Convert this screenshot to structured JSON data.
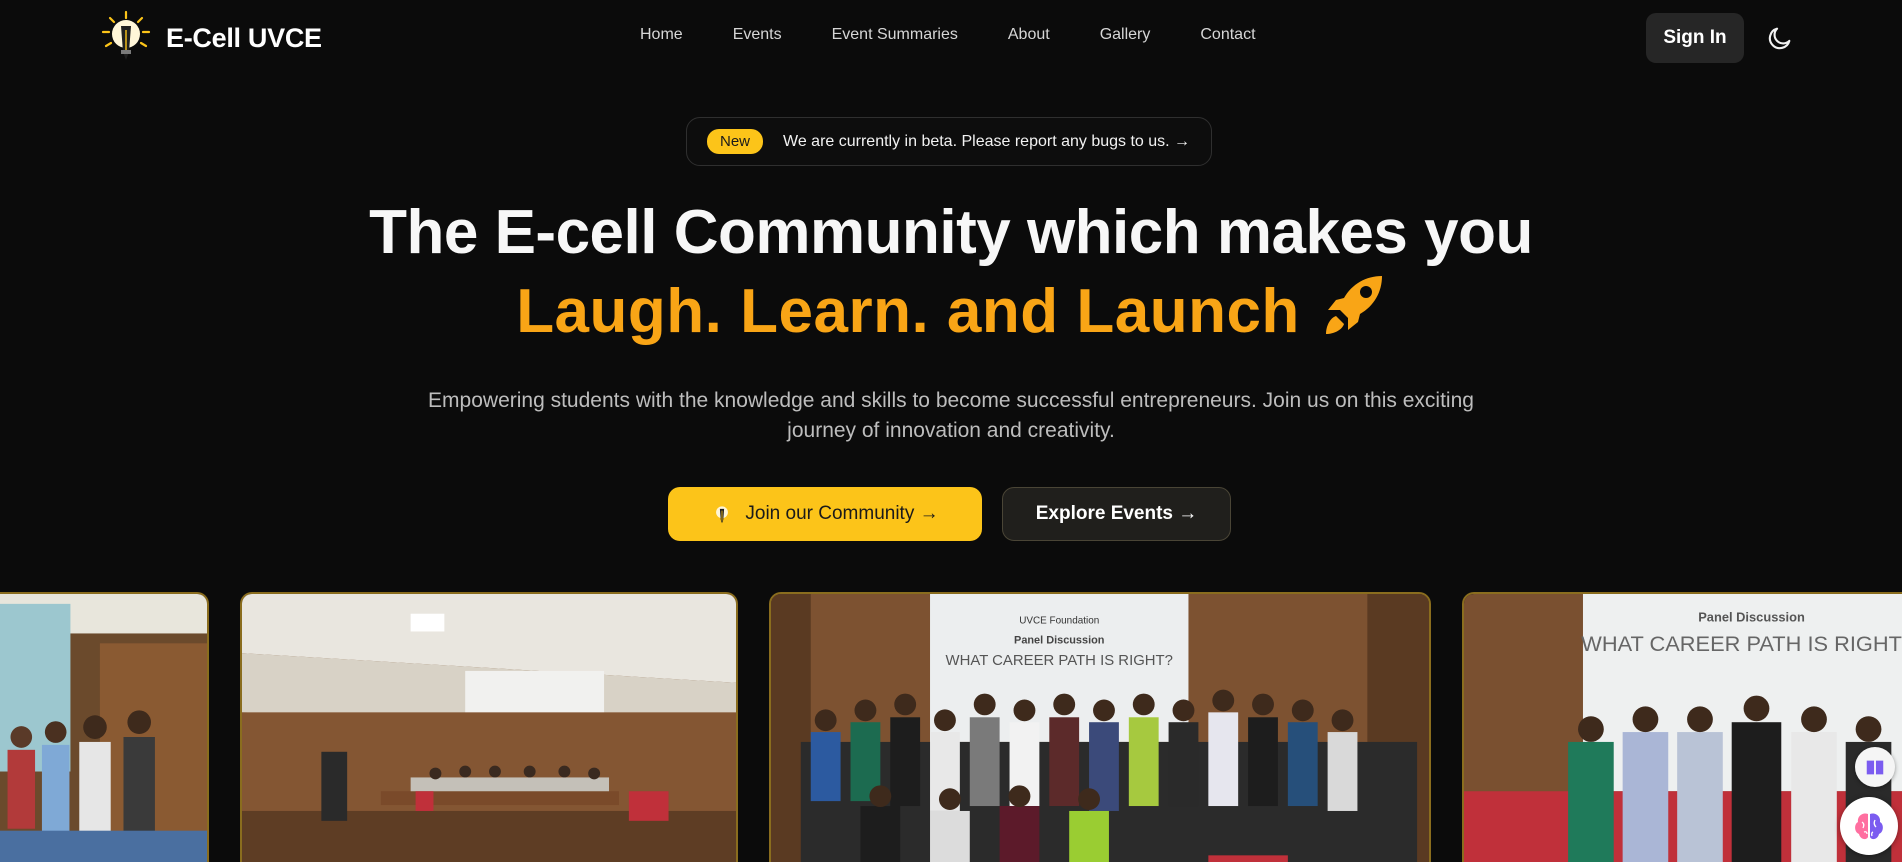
{
  "brand": {
    "name": "E-Cell UVCE",
    "logo_icon": "lightbulb-pen-icon"
  },
  "nav": {
    "items": [
      {
        "label": "Home"
      },
      {
        "label": "Events"
      },
      {
        "label": "Event Summaries"
      },
      {
        "label": "About"
      },
      {
        "label": "Gallery"
      },
      {
        "label": "Contact"
      }
    ]
  },
  "header": {
    "signin_label": "Sign In",
    "theme_icon": "moon-icon"
  },
  "beta": {
    "badge": "New",
    "text": "We are currently in beta. Please report any bugs to us. →"
  },
  "hero": {
    "line1": "The E-cell Community which makes you",
    "line2": "Laugh. Learn. and Launch",
    "line2_icon": "rocket-icon",
    "subtitle": "Empowering students with the knowledge and skills to become successful entrepreneurs. Join us on this exciting journey of innovation and creativity."
  },
  "cta": {
    "join_label": "Join our Community →",
    "join_icon": "lightbulb-pen-icon",
    "explore_label": "Explore Events →"
  },
  "gallery": {
    "p3_screen_title": "Panel Discussion",
    "p3_screen_text": "WHAT CAREER PATH IS RIGHT?",
    "p3_screen_brand": "UVCE Foundation",
    "p4_screen_title": "Panel Discussion",
    "p4_screen_text": "WHAT CAREER PATH IS RIGHT"
  },
  "widgets": {
    "book_icon": "book-icon",
    "brain_icon": "brain-icon"
  },
  "colors": {
    "background": "#0b0b0b",
    "accent_yellow": "#fcc419",
    "accent_orange": "#f9a516",
    "photo_border": "#8a6d1e"
  }
}
